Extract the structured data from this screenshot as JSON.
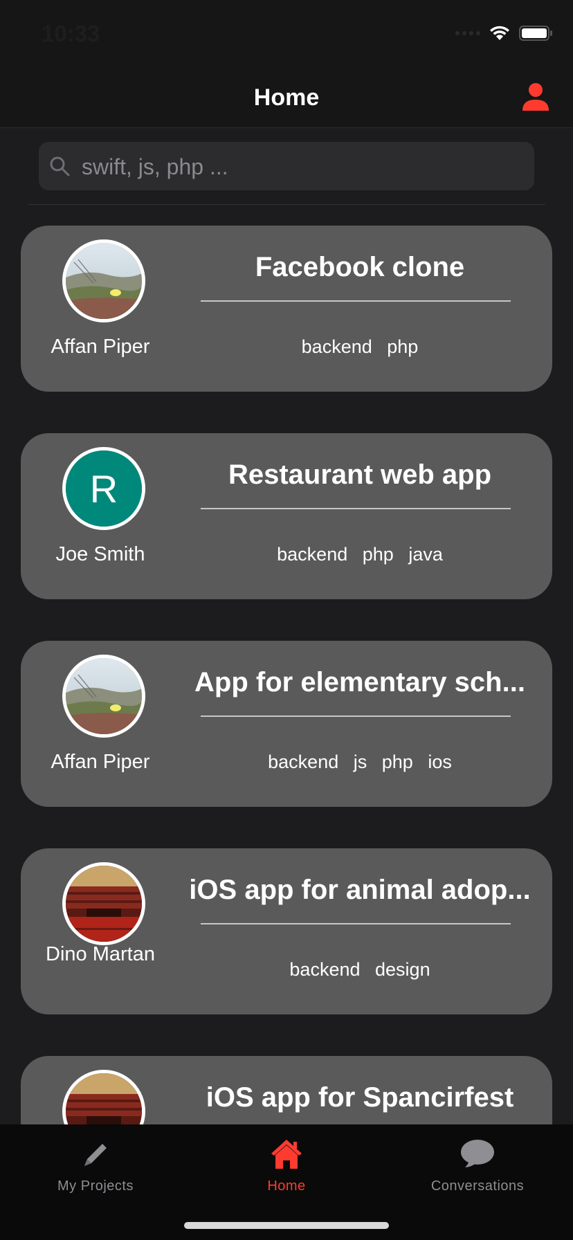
{
  "status_bar": {
    "time": "10:33"
  },
  "nav": {
    "title": "Home",
    "profile_icon": "person-icon",
    "accent": "#ff3b30"
  },
  "search": {
    "placeholder": "swift, js, php ...",
    "value": ""
  },
  "projects": [
    {
      "title": "Facebook clone",
      "author": "Affan Piper",
      "avatar": "landscape-photo",
      "tags": [
        "backend",
        "php"
      ]
    },
    {
      "title": "Restaurant web app",
      "author": "Joe Smith",
      "avatar_initial": "R",
      "avatar_color": "#00897b",
      "tags": [
        "backend",
        "php",
        "java"
      ]
    },
    {
      "title": "App for elementary sch...",
      "author": "Affan Piper",
      "avatar": "landscape-photo",
      "tags": [
        "backend",
        "js",
        "php",
        "ios"
      ]
    },
    {
      "title": "iOS app for animal adop...",
      "author": "Dino Martan",
      "avatar": "theater-photo",
      "tags": [
        "backend",
        "design"
      ]
    },
    {
      "title": "iOS app for Spancirfest",
      "author": "",
      "avatar": "theater-photo",
      "tags": []
    }
  ],
  "tabs": [
    {
      "label": "My Projects",
      "icon": "pencil-icon",
      "active": false
    },
    {
      "label": "Home",
      "icon": "house-icon",
      "active": true
    },
    {
      "label": "Conversations",
      "icon": "chat-bubble-icon",
      "active": false
    }
  ]
}
